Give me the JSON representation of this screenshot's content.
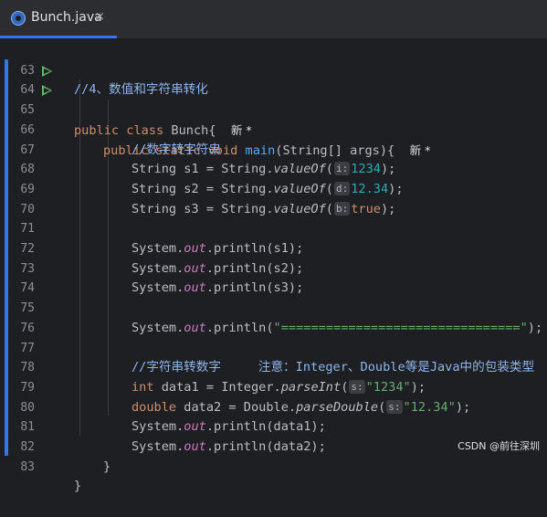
{
  "tab": {
    "filename": "Bunch.java",
    "close": "×"
  },
  "lines": {
    "l63": {
      "num": "63",
      "comment": "//4、数值和字符串转化"
    },
    "l64": {
      "num": "64",
      "kw1": "public",
      "kw2": "class",
      "name": "Bunch{",
      "author": "新 *"
    },
    "l65": {
      "num": "65",
      "kw1": "public",
      "kw2": "static",
      "kw3": "void",
      "fn": "main",
      "params": "(String[] args){",
      "author": "新 *"
    },
    "l66": {
      "num": "66",
      "comment": "//数字转字符串"
    },
    "l67": {
      "num": "67",
      "pre": "String s1 = String.",
      "call": "valueOf",
      "open": "(",
      "hint": "i:",
      "arg": "1234",
      "close": ");"
    },
    "l68": {
      "num": "68",
      "pre": "String s2 = String.",
      "call": "valueOf",
      "open": "(",
      "hint": "d:",
      "arg": "12.34",
      "close": ");"
    },
    "l69": {
      "num": "69",
      "pre": "String s3 = String.",
      "call": "valueOf",
      "open": "(",
      "hint": "b:",
      "arg": "true",
      "close": ");"
    },
    "l70": {
      "num": "70"
    },
    "l71": {
      "num": "71",
      "pre": "System.",
      "field": "out",
      "post": ".println(s1);"
    },
    "l72": {
      "num": "72",
      "pre": "System.",
      "field": "out",
      "post": ".println(s2);"
    },
    "l73": {
      "num": "73",
      "pre": "System.",
      "field": "out",
      "post": ".println(s3);"
    },
    "l74": {
      "num": "74"
    },
    "l75": {
      "num": "75",
      "pre": "System.",
      "field": "out",
      "mid": ".println(",
      "str": "\"================================\"",
      "post": ");"
    },
    "l76": {
      "num": "76"
    },
    "l77": {
      "num": "77",
      "comment": "//字符串转数字",
      "note": "注意：Integer、Double等是Java中的包装类型"
    },
    "l78": {
      "num": "78",
      "type": "int",
      "pre": "data1 = Integer.",
      "call": "parseInt",
      "open": "(",
      "hint": "s:",
      "str": "\"1234\"",
      "close": ");"
    },
    "l79": {
      "num": "79",
      "type": "double",
      "pre": "data2 = Double.",
      "call": "parseDouble",
      "open": "(",
      "hint": "s:",
      "str": "\"12.34\"",
      "close": ");"
    },
    "l80": {
      "num": "80",
      "pre": "System.",
      "field": "out",
      "post": ".println(data1);"
    },
    "l81": {
      "num": "81",
      "pre": "System.",
      "field": "out",
      "post": ".println(data2);"
    },
    "l82": {
      "num": "82",
      "brace": "}"
    },
    "l83": {
      "num": "83",
      "brace": "}"
    }
  },
  "watermark": "CSDN @前往深圳"
}
